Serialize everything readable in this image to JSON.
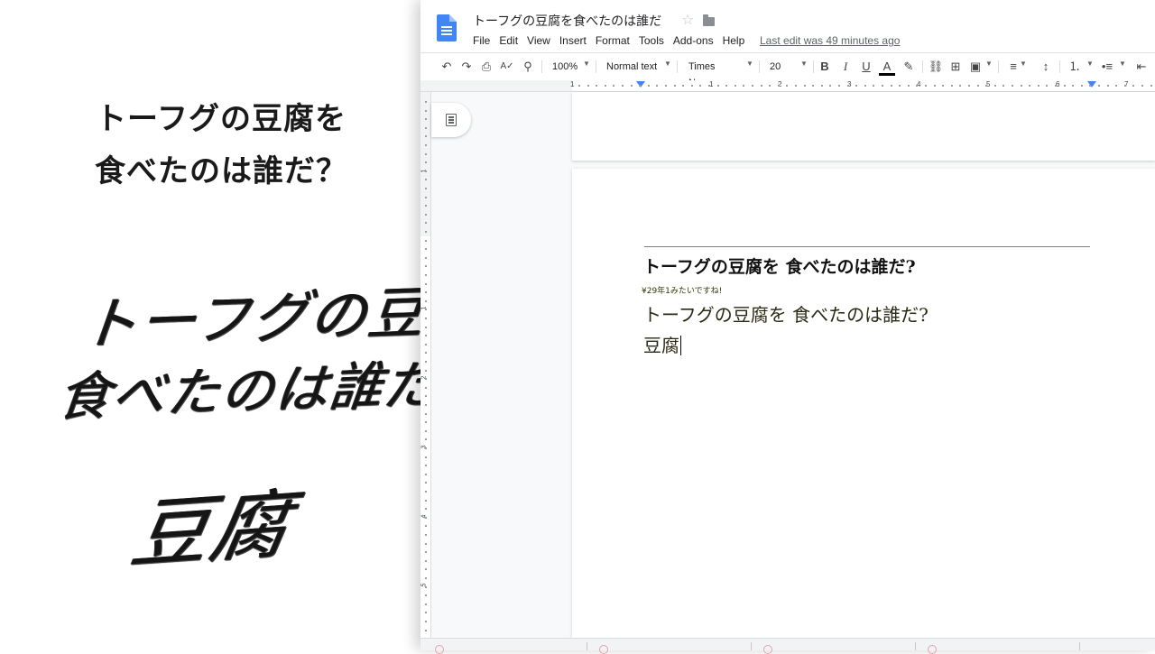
{
  "left_panel": {
    "headline_line_1": "トーフグの豆腐を",
    "headline_line_2": "食べたのは誰だ？",
    "brush_line_1": "トーフグの豆腐を",
    "brush_line_2": "食べたのは誰だ？",
    "brush_line_3": "豆腐"
  },
  "window": {
    "doc_title": "トーフグの豆腐を食べたのは誰だ",
    "last_edit": "Last edit was 49 minutes ago",
    "menu": [
      "File",
      "Edit",
      "View",
      "Insert",
      "Format",
      "Tools",
      "Add-ons",
      "Help"
    ]
  },
  "toolbar": {
    "zoom": "100%",
    "style": "Normal text",
    "font": "Times New...",
    "font_size": "20",
    "undo_icon": "↶",
    "redo_icon": "↷",
    "print_icon": "⎙",
    "spellcheck_icon": "A✓",
    "paint_format_icon": "⚲",
    "bold": "B",
    "italic": "I",
    "underline": "U",
    "text_color": "A",
    "highlight_icon": "✎",
    "link_icon": "⛓",
    "comment_icon": "⊞",
    "image_icon": "▣",
    "align_icon": "≡",
    "line_spacing_icon": "↕",
    "numbered_list_icon": "⒈",
    "bulleted_list_icon": "•≡",
    "indent_icon": "⇤"
  },
  "ruler": {
    "numbers": [
      "1",
      "1",
      "2",
      "3",
      "4",
      "5",
      "6",
      "7"
    ],
    "vertical_numbers": [
      "1",
      "1",
      "2",
      "3",
      "4",
      "5"
    ]
  },
  "document": {
    "heading": "トーフグの豆腐を 食べたのは誰だ?",
    "note": "¥29年1みたいですね!",
    "line_2": "トーフグの豆腐を 食べたのは誰だ?",
    "line_3": "豆腐"
  },
  "icons": {
    "star": "☆",
    "folder": "folder-icon",
    "outline": "outline-icon",
    "docs_logo": "google-docs-icon"
  }
}
